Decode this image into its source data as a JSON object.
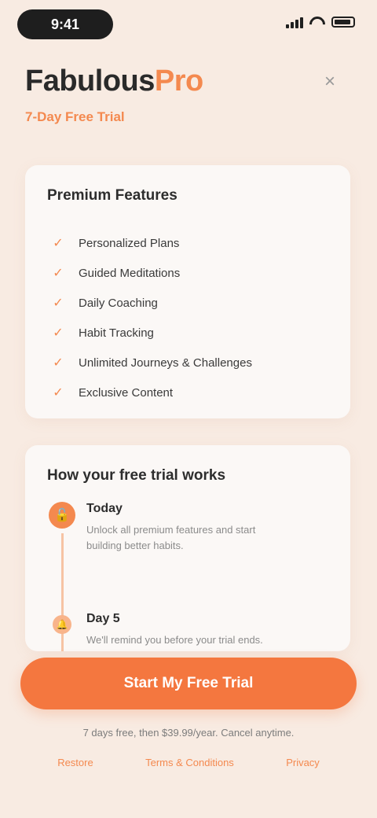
{
  "status_bar": {
    "time": "9:41"
  },
  "header": {
    "brand_main": "Fabulous",
    "brand_accent": "Pro",
    "tagline": "7-Day Free Trial",
    "close_icon": "×"
  },
  "features": {
    "title": "Premium Features",
    "items": [
      {
        "label": "Personalized Plans"
      },
      {
        "label": "Guided Meditations"
      },
      {
        "label": "Daily Coaching"
      },
      {
        "label": "Habit Tracking"
      },
      {
        "label": "Unlimited Journeys & Challenges"
      },
      {
        "label": "Exclusive Content"
      }
    ]
  },
  "trial": {
    "title": "How your free trial works",
    "steps": [
      {
        "label": "Today",
        "desc": "Unlock all premium features and start building better habits."
      },
      {
        "label": "Day 5",
        "desc": "We'll remind you before your trial ends."
      }
    ]
  },
  "cta": {
    "label": "Start My Free Trial"
  },
  "fine_print": "7 days free, then $39.99/year. Cancel anytime.",
  "footer": {
    "links": [
      {
        "label": "Restore"
      },
      {
        "label": "Terms & Conditions"
      },
      {
        "label": "Privacy"
      }
    ]
  },
  "colors": {
    "accent": "#f4894f",
    "background": "#f8ebe2",
    "cta": "#f4773f"
  }
}
